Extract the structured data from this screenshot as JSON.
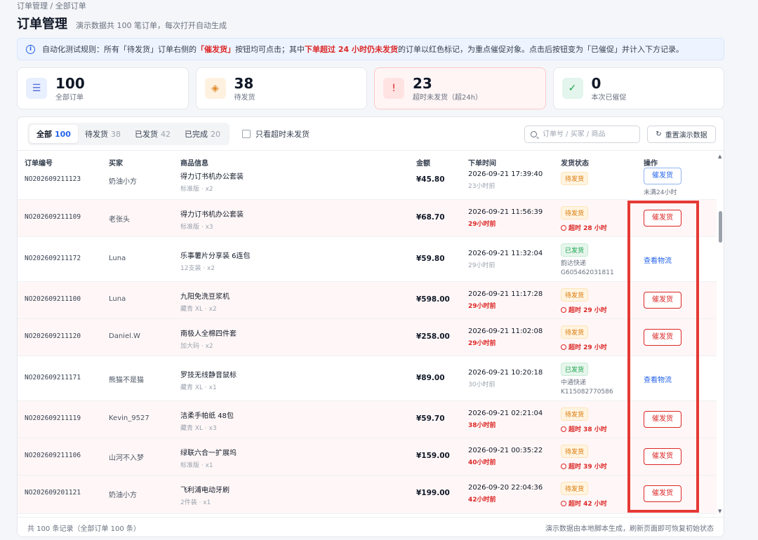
{
  "breadcrumb": "订单管理 / 全部订单",
  "header": {
    "title": "订单管理",
    "subtitle": "演示数据共 100 笔订单，每次打开自动生成"
  },
  "notice": {
    "prefix": "自动化测试规则：所有「待发货」订单右侧的",
    "btn": "「催发货」",
    "mid": "按钮均可点击；其中",
    "rule": "下单超过 24 小时仍未发货",
    "suffix": "的订单以红色标记，为重点催促对象。点击后按钮变为「已催促」并计入下方记录。"
  },
  "stats": [
    {
      "value": "100",
      "label": "全部订单",
      "icon": "list-icon"
    },
    {
      "value": "38",
      "label": "待发货",
      "icon": "box-icon"
    },
    {
      "value": "23",
      "label": "超时未发货（超24h）",
      "icon": "alert-icon"
    },
    {
      "value": "0",
      "label": "本次已催促",
      "icon": "check-icon"
    }
  ],
  "tabs": [
    {
      "label": "全部",
      "count": "100"
    },
    {
      "label": "待发货",
      "count": "38"
    },
    {
      "label": "已发货",
      "count": "42"
    },
    {
      "label": "已完成",
      "count": "20"
    }
  ],
  "filter": {
    "only_overdue": "只看超时未发货"
  },
  "search": {
    "placeholder": "订单号 / 买家 / 商品"
  },
  "reset_label": "重置演示数据",
  "columns": {
    "order_id": "订单编号",
    "buyer": "买家",
    "goods": "商品信息",
    "amount": "金额",
    "time": "下单时间",
    "ship": "发货状态",
    "op": "操作"
  },
  "rows": [
    {
      "id": "NO202609211123",
      "buyer": "奶油小方",
      "goods": "得力订书机办公套装",
      "spec": "标准版 · x2",
      "amount": "¥45.80",
      "time": "2026-09-21 17:39:40",
      "ago": "23小时前",
      "status": "待发货",
      "warn": "",
      "info": "",
      "op": "催发货",
      "note": "未满24小时"
    },
    {
      "id": "NO202609211109",
      "buyer": "老张头",
      "goods": "得力订书机办公套装",
      "spec": "标准版 · x3",
      "amount": "¥68.70",
      "time": "2026-09-21 11:56:39",
      "ago": "29小时前",
      "status": "待发货",
      "warn": "超时 28 小时",
      "info": "",
      "op": "催发货",
      "note": ""
    },
    {
      "id": "NO202609211172",
      "buyer": "Luna",
      "goods": "乐事薯片分享装 6连包",
      "spec": "12支装 · x2",
      "amount": "¥59.80",
      "time": "2026-09-21 11:32:04",
      "ago": "29小时前",
      "status": "已发货",
      "warn": "",
      "info": "韵达快递\nG605462031811",
      "op": "查看物流",
      "note": ""
    },
    {
      "id": "NO202609211100",
      "buyer": "Luna",
      "goods": "九阳免洗豆浆机",
      "spec": "藏青 XL · x2",
      "amount": "¥598.00",
      "time": "2026-09-21 11:17:28",
      "ago": "29小时前",
      "status": "待发货",
      "warn": "超时 29 小时",
      "info": "",
      "op": "催发货",
      "note": ""
    },
    {
      "id": "NO202609211120",
      "buyer": "Daniel.W",
      "goods": "南极人全棉四件套",
      "spec": "加大码 · x2",
      "amount": "¥258.00",
      "time": "2026-09-21 11:02:08",
      "ago": "29小时前",
      "status": "待发货",
      "warn": "超时 29 小时",
      "info": "",
      "op": "催发货",
      "note": ""
    },
    {
      "id": "NO202609211171",
      "buyer": "熊猫不是猫",
      "goods": "罗技无线静音鼠标",
      "spec": "藏青 XL · x1",
      "amount": "¥89.00",
      "time": "2026-09-21 10:20:18",
      "ago": "30小时前",
      "status": "已发货",
      "warn": "",
      "info": "中通快递\nK115082770586",
      "op": "查看物流",
      "note": ""
    },
    {
      "id": "NO202609211119",
      "buyer": "Kevin_9527",
      "goods": "洁柔手帕纸 48包",
      "spec": "藏青 XL · x3",
      "amount": "¥59.70",
      "time": "2026-09-21 02:21:04",
      "ago": "38小时前",
      "status": "待发货",
      "warn": "超时 38 小时",
      "info": "",
      "op": "催发货",
      "note": ""
    },
    {
      "id": "NO202609211106",
      "buyer": "山河不入梦",
      "goods": "绿联六合一扩展坞",
      "spec": "标准版 · x1",
      "amount": "¥159.00",
      "time": "2026-09-21 00:35:22",
      "ago": "40小时前",
      "status": "待发货",
      "warn": "超时 39 小时",
      "info": "",
      "op": "催发货",
      "note": ""
    },
    {
      "id": "NO202609201121",
      "buyer": "奶油小方",
      "goods": "飞利浦电动牙刷",
      "spec": "2件装 · x1",
      "amount": "¥199.00",
      "time": "2026-09-20 22:04:36",
      "ago": "42小时前",
      "status": "待发货",
      "warn": "超时 42 小时",
      "info": "",
      "op": "催发货",
      "note": ""
    }
  ],
  "footer": {
    "left": "共 100 条记录（全部订单 100 条）",
    "right": "演示数据由本地脚本生成，刷新页面即可恢复初始状态"
  }
}
